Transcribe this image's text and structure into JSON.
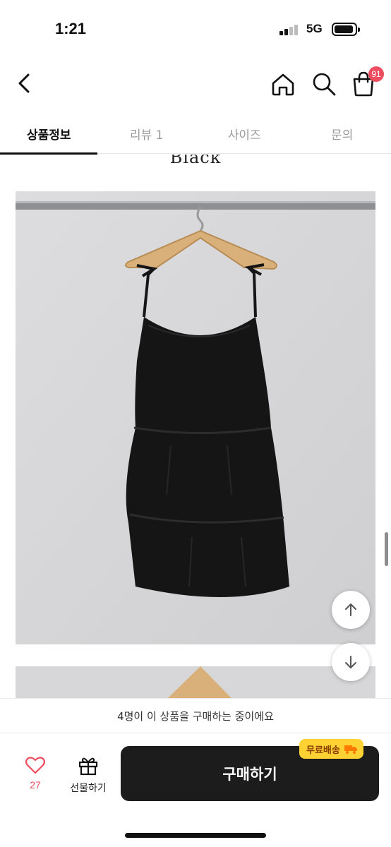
{
  "status_bar": {
    "time": "1:21",
    "network": "5G"
  },
  "header": {
    "cart_count": "91"
  },
  "tabs": [
    {
      "label": "상품정보",
      "active": true
    },
    {
      "label": "리뷰 1",
      "active": false
    },
    {
      "label": "사이즈",
      "active": false
    },
    {
      "label": "문의",
      "active": false
    }
  ],
  "content": {
    "brand_text": "Black"
  },
  "purchase_notice": "4명이 이 상품을 구매하는 중이에요",
  "bottom_bar": {
    "like_count": "27",
    "gift_label": "선물하기",
    "buy_label": "구매하기",
    "free_shipping_label": "무료배송"
  },
  "colors": {
    "accent": "#ee4d5f",
    "buy_button": "#1c1c1c",
    "shipping_badge": "#ffd233"
  },
  "icons": [
    "back-icon",
    "home-icon",
    "search-icon",
    "cart-icon",
    "arrow-up-icon",
    "arrow-down-icon",
    "heart-icon",
    "gift-icon",
    "truck-icon"
  ]
}
